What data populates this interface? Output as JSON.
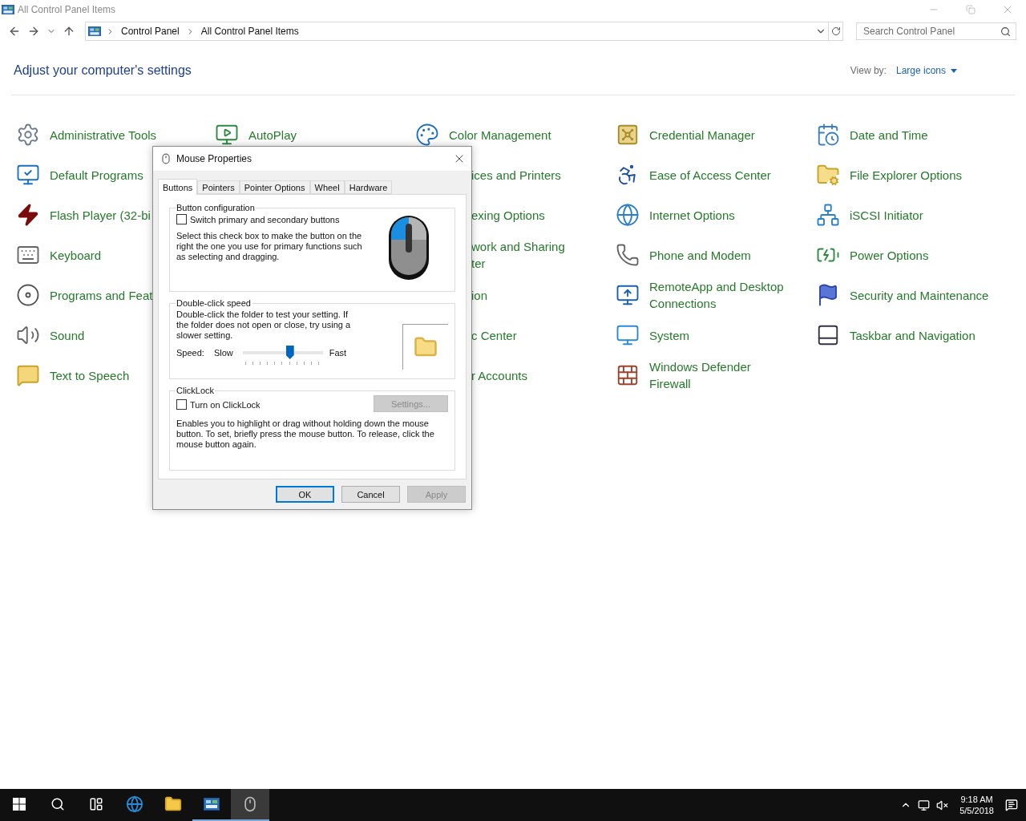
{
  "window": {
    "title": "All Control Panel Items"
  },
  "address": {
    "breadcrumbs": [
      "Control Panel",
      "All Control Panel Items"
    ]
  },
  "search": {
    "placeholder": "Search Control Panel"
  },
  "heading": "Adjust your computer's settings",
  "view_by": {
    "label": "View by:",
    "value": "Large icons"
  },
  "columns": [
    [
      {
        "label": "Administrative Tools",
        "icon_visible": true
      },
      {
        "label": "Default Programs",
        "icon_visible": true
      },
      {
        "label": "Flash Player (32-bi",
        "icon_visible": true
      },
      {
        "label": "Keyboard",
        "icon_visible": true
      },
      {
        "label": "Programs and Feat",
        "icon_visible": true
      },
      {
        "label": "Sound",
        "icon_visible": true
      },
      {
        "label": "Text to Speech",
        "icon_visible": true
      }
    ],
    [
      {
        "label": "AutoPlay",
        "icon_visible": true
      }
    ],
    [
      {
        "label": "Color Management",
        "icon_visible": true
      },
      {
        "label": "ices and Printers",
        "icon_visible": false
      },
      {
        "label": "exing Options",
        "icon_visible": false
      },
      {
        "label": "work and Sharing ter",
        "icon_visible": false
      },
      {
        "label": "ion",
        "icon_visible": false
      },
      {
        "label": "c Center",
        "icon_visible": false
      },
      {
        "label": "r Accounts",
        "icon_visible": false
      }
    ],
    [
      {
        "label": "Credential Manager",
        "icon_visible": true
      },
      {
        "label": "Ease of Access Center",
        "icon_visible": true
      },
      {
        "label": "Internet Options",
        "icon_visible": true
      },
      {
        "label": "Phone and Modem",
        "icon_visible": true
      },
      {
        "label": "RemoteApp and Desktop Connections",
        "icon_visible": true
      },
      {
        "label": "System",
        "icon_visible": true
      },
      {
        "label": "Windows Defender Firewall",
        "icon_visible": true
      }
    ],
    [
      {
        "label": "Date and Time",
        "icon_visible": true
      },
      {
        "label": "File Explorer Options",
        "icon_visible": true
      },
      {
        "label": "iSCSI Initiator",
        "icon_visible": true
      },
      {
        "label": "Power Options",
        "icon_visible": true
      },
      {
        "label": "Security and Maintenance",
        "icon_visible": true
      },
      {
        "label": "Taskbar and Navigation",
        "icon_visible": true
      }
    ]
  ],
  "dialog": {
    "title": "Mouse Properties",
    "tabs": [
      {
        "label": "Buttons",
        "selected": true
      },
      {
        "label": "Pointers",
        "selected": false
      },
      {
        "label": "Pointer Options",
        "selected": false
      },
      {
        "label": "Wheel",
        "selected": false
      },
      {
        "label": "Hardware",
        "selected": false
      }
    ],
    "button_configuration": {
      "title": "Button configuration",
      "checkbox": {
        "label": "Switch primary and secondary buttons",
        "checked": false
      },
      "description": "Select this check box to make the button on the right the one you use for primary functions such as selecting and dragging."
    },
    "double_click_speed": {
      "title": "Double-click speed",
      "description": "Double-click the folder to test your setting. If the folder does not open or close, try using a slower setting.",
      "speed_label": "Speed:",
      "slow_label": "Slow",
      "fast_label": "Fast",
      "level": 0.59
    },
    "clicklock": {
      "title": "ClickLock",
      "checkbox": {
        "label": "Turn on ClickLock",
        "checked": false
      },
      "settings_button": {
        "label": "Settings...",
        "disabled": true
      },
      "description": "Enables you to highlight or drag without holding down the mouse button. To set, briefly press the mouse button. To release, click the mouse button again."
    },
    "buttons": [
      {
        "label": "OK",
        "default": true,
        "disabled": false
      },
      {
        "label": "Cancel",
        "default": false,
        "disabled": false
      },
      {
        "label": "Apply",
        "default": false,
        "disabled": true
      }
    ]
  },
  "taskbar": {
    "apps": [
      {
        "running": false,
        "selected": false
      },
      {
        "running": false,
        "selected": false
      },
      {
        "running": true,
        "selected": false
      },
      {
        "running": true,
        "selected": true
      }
    ],
    "clock": {
      "time": "9:18 AM",
      "date": "5/5/2018"
    }
  }
}
